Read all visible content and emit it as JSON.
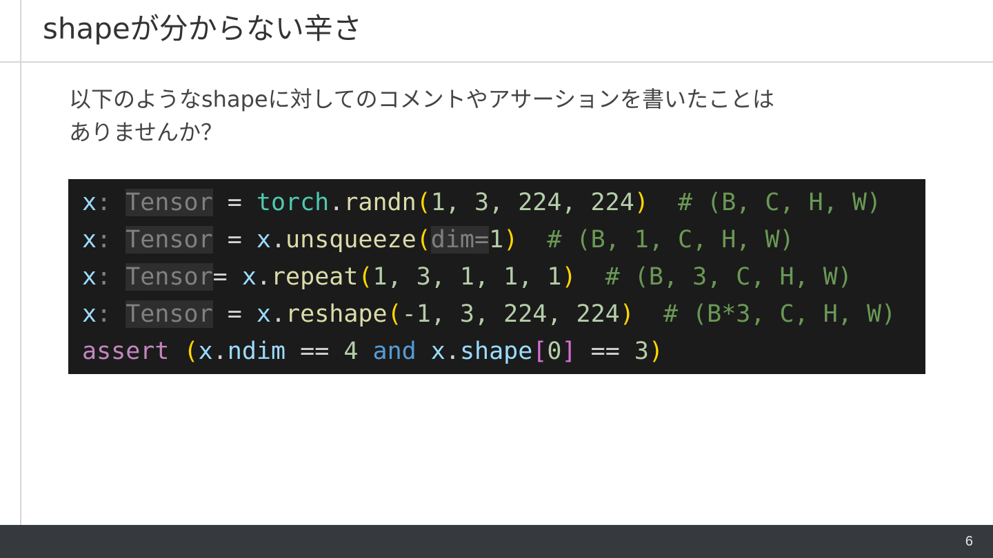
{
  "slide": {
    "title": "shapeが分からない辛さ",
    "intro_lines": [
      "以下のようなshapeに対してのコメントやアサーションを書いたことは",
      "ありませんか？"
    ],
    "page_number": "6"
  },
  "colors": {
    "variable": "#9cdcfe",
    "type": "#808080",
    "operator": "#d4d4d4",
    "module": "#4ec9b0",
    "function": "#dcdcaa",
    "paren": "#ffd700",
    "number": "#b5cea8",
    "comment": "#6a9955",
    "keyword_control": "#c586c0",
    "keyword_logic": "#569cd6",
    "bracket": "#da70d6",
    "footer_bg": "#363a3e"
  },
  "code": [
    [
      {
        "t": "x",
        "c": "variable"
      },
      {
        "t": ": ",
        "c": "type"
      },
      {
        "t": "Tensor",
        "c": "type",
        "hl": true
      },
      {
        "t": " = ",
        "c": "operator"
      },
      {
        "t": "torch",
        "c": "module"
      },
      {
        "t": ".",
        "c": "operator"
      },
      {
        "t": "randn",
        "c": "function"
      },
      {
        "t": "(",
        "c": "paren"
      },
      {
        "t": "1, 3, 224, 224",
        "c": "number"
      },
      {
        "t": ")",
        "c": "paren"
      },
      {
        "t": "  # (B, C, H, W)",
        "c": "comment"
      }
    ],
    [
      {
        "t": "x",
        "c": "variable"
      },
      {
        "t": ": ",
        "c": "type"
      },
      {
        "t": "Tensor",
        "c": "type",
        "hl": true
      },
      {
        "t": " = ",
        "c": "operator"
      },
      {
        "t": "x",
        "c": "variable"
      },
      {
        "t": ".",
        "c": "operator"
      },
      {
        "t": "unsqueeze",
        "c": "function"
      },
      {
        "t": "(",
        "c": "paren"
      },
      {
        "t": "dim=",
        "c": "type",
        "hl": true
      },
      {
        "t": "1",
        "c": "number"
      },
      {
        "t": ")",
        "c": "paren"
      },
      {
        "t": "  # (B, 1, C, H, W)",
        "c": "comment"
      }
    ],
    [
      {
        "t": "x",
        "c": "variable"
      },
      {
        "t": ": ",
        "c": "type"
      },
      {
        "t": "Tensor",
        "c": "type",
        "hl": true
      },
      {
        "t": "= ",
        "c": "operator"
      },
      {
        "t": "x",
        "c": "variable"
      },
      {
        "t": ".",
        "c": "operator"
      },
      {
        "t": "repeat",
        "c": "function"
      },
      {
        "t": "(",
        "c": "paren"
      },
      {
        "t": "1, 3, 1, 1, 1",
        "c": "number"
      },
      {
        "t": ")",
        "c": "paren"
      },
      {
        "t": "  # (B, 3, C, H, W)",
        "c": "comment"
      }
    ],
    [
      {
        "t": "x",
        "c": "variable"
      },
      {
        "t": ": ",
        "c": "type"
      },
      {
        "t": "Tensor",
        "c": "type",
        "hl": true
      },
      {
        "t": " = ",
        "c": "operator"
      },
      {
        "t": "x",
        "c": "variable"
      },
      {
        "t": ".",
        "c": "operator"
      },
      {
        "t": "reshape",
        "c": "function"
      },
      {
        "t": "(",
        "c": "paren"
      },
      {
        "t": "-1, 3, 224, 224",
        "c": "number"
      },
      {
        "t": ")",
        "c": "paren"
      },
      {
        "t": "  # (B*3, C, H, W)",
        "c": "comment"
      }
    ],
    [
      {
        "t": "assert",
        "c": "keyword_control"
      },
      {
        "t": " ",
        "c": "operator"
      },
      {
        "t": "(",
        "c": "paren"
      },
      {
        "t": "x",
        "c": "variable"
      },
      {
        "t": ".",
        "c": "operator"
      },
      {
        "t": "ndim",
        "c": "variable"
      },
      {
        "t": " == ",
        "c": "operator"
      },
      {
        "t": "4",
        "c": "number"
      },
      {
        "t": " ",
        "c": "operator"
      },
      {
        "t": "and",
        "c": "keyword_logic"
      },
      {
        "t": " ",
        "c": "operator"
      },
      {
        "t": "x",
        "c": "variable"
      },
      {
        "t": ".",
        "c": "operator"
      },
      {
        "t": "shape",
        "c": "variable"
      },
      {
        "t": "[",
        "c": "bracket"
      },
      {
        "t": "0",
        "c": "number"
      },
      {
        "t": "]",
        "c": "bracket"
      },
      {
        "t": " == ",
        "c": "operator"
      },
      {
        "t": "3",
        "c": "number"
      },
      {
        "t": ")",
        "c": "paren"
      }
    ]
  ]
}
